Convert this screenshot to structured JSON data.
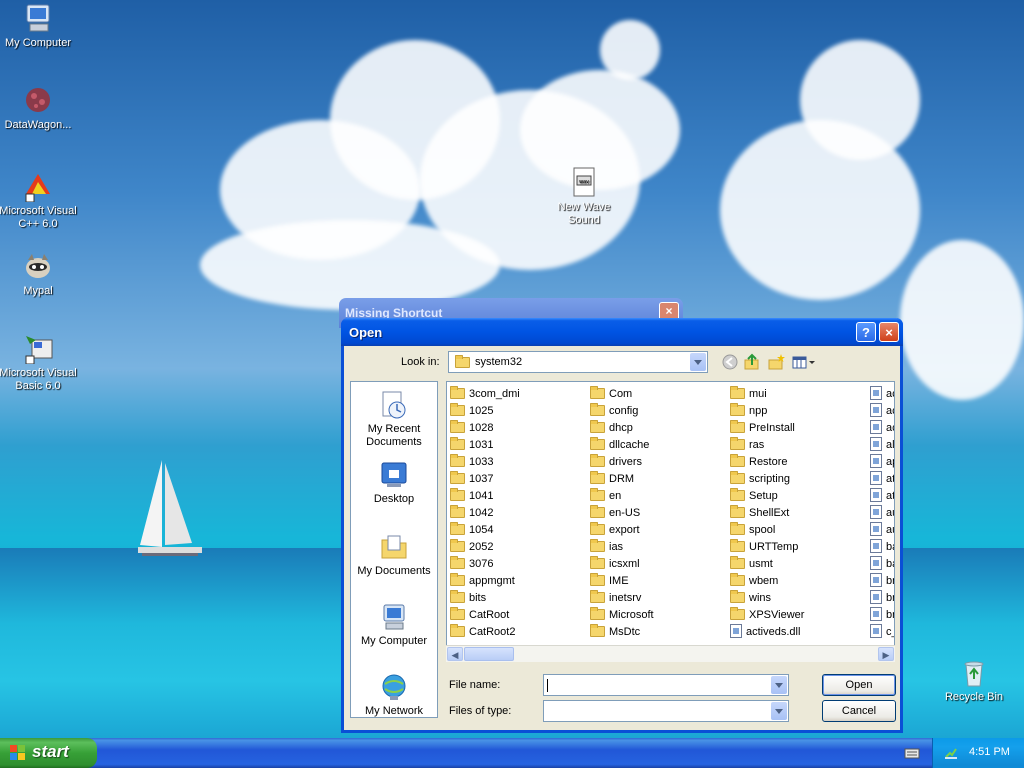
{
  "desktop": {
    "icons": [
      {
        "label": "My Computer"
      },
      {
        "label": "DataWagon..."
      },
      {
        "label": "Microsoft Visual C++ 6.0"
      },
      {
        "label": "Mypal"
      },
      {
        "label": "Microsoft Visual Basic 6.0"
      },
      {
        "label": "New Wave Sound"
      },
      {
        "label": "Recycle Bin"
      }
    ]
  },
  "background_window": {
    "title": "Missing Shortcut",
    "close_glyph": "×"
  },
  "dialog": {
    "title": "Open",
    "help_glyph": "?",
    "close_glyph": "×",
    "look_in_label": "Look in:",
    "look_in_value": "system32",
    "places": [
      {
        "label": "My Recent Documents"
      },
      {
        "label": "Desktop"
      },
      {
        "label": "My Documents"
      },
      {
        "label": "My Computer"
      },
      {
        "label": "My Network"
      }
    ],
    "columns": [
      [
        "3com_dmi",
        "1025",
        "1028",
        "1031",
        "1033",
        "1037",
        "1041",
        "1042",
        "1054",
        "2052",
        "3076",
        "appmgmt",
        "bits",
        "CatRoot",
        "CatRoot2"
      ],
      [
        "Com",
        "config",
        "dhcp",
        "dllcache",
        "drivers",
        "DRM",
        "en",
        "en-US",
        "export",
        "ias",
        "icsxml",
        "IME",
        "inetsrv",
        "Microsoft",
        "MsDtc"
      ],
      [
        "mui",
        "npp",
        "PreInstall",
        "ras",
        "Restore",
        "scripting",
        "Setup",
        "ShellExt",
        "spool",
        "URTTemp",
        "usmt",
        "wbem",
        "wins",
        "XPSViewer",
        "activeds.dll"
      ],
      [
        "ac",
        "ac",
        "ac",
        "al",
        "ap",
        "at",
        "at",
        "au",
        "au",
        "ba",
        "ba",
        "br",
        "br",
        "br",
        "c_"
      ]
    ],
    "file_name_label": "File name:",
    "file_name_value": "",
    "files_of_type_label": "Files of type:",
    "files_of_type_value": "",
    "open_button": "Open",
    "cancel_button": "Cancel"
  },
  "taskbar": {
    "start_label": "start",
    "clock": "4:51 PM"
  }
}
